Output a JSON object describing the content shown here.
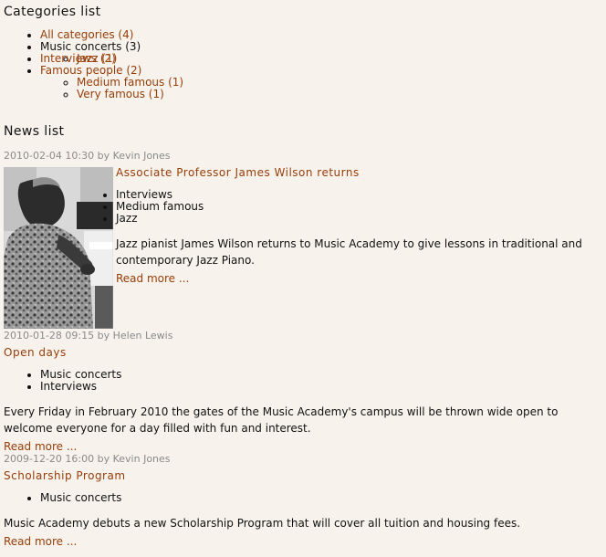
{
  "categories": {
    "title": "Categories list",
    "all": "All categories (4)",
    "music": "Music concerts (3)",
    "jazz": "Jazz (1)",
    "interviews": "Interviews (2)",
    "famous": "Famous people (2)",
    "medium": "Medium famous (1)",
    "very": "Very famous (1)"
  },
  "news": {
    "title": "News list",
    "items": [
      {
        "meta": "2010-02-04 10:30 by Kevin Jones",
        "title": "Associate Professor James Wilson returns",
        "tags": [
          "Interviews",
          "Medium famous",
          "Jazz"
        ],
        "summary": "Jazz pianist James Wilson returns to Music Academy to give lessons in traditional and contemporary Jazz Piano.",
        "read_more": "Read more ..."
      },
      {
        "meta": "2010-01-28 09:15 by Helen Lewis",
        "title": "Open days",
        "tags": [
          "Music concerts",
          "Interviews"
        ],
        "summary": "Every Friday in February 2010 the gates of the Music Academy's campus will be thrown wide open to welcome everyone for a day filled with fun and interest.",
        "read_more": "Read more ..."
      },
      {
        "meta": "2009-12-20 16:00 by Kevin Jones",
        "title": "Scholarship Program",
        "tags": [
          "Music concerts"
        ],
        "summary": "Music Academy debuts a new Scholarship Program that will cover all tuition and housing fees.",
        "read_more": "Read more ..."
      }
    ]
  }
}
